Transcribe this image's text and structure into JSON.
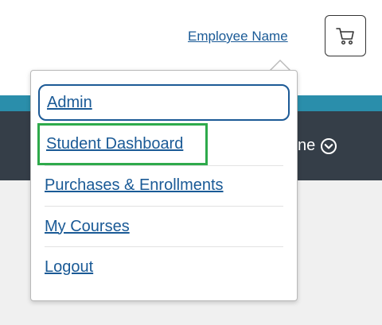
{
  "header": {
    "employee_link": "Employee Name",
    "cart_icon": "shopping-cart-icon"
  },
  "band": {
    "menu_label_partial": "ne",
    "chevron_icon": "chevron-down-circle-icon"
  },
  "dropdown": {
    "items": [
      {
        "label": "Admin",
        "state": "focused"
      },
      {
        "label": "Student Dashboard",
        "state": "highlighted"
      },
      {
        "label": "Purchases & Enrollments"
      },
      {
        "label": "My Courses"
      },
      {
        "label": "Logout"
      }
    ]
  },
  "colors": {
    "link": "#1a5a96",
    "teal": "#2a8eab",
    "dark_band": "#353e48",
    "highlight_green": "#2eaa4b",
    "focus_blue": "#1c5a96"
  }
}
